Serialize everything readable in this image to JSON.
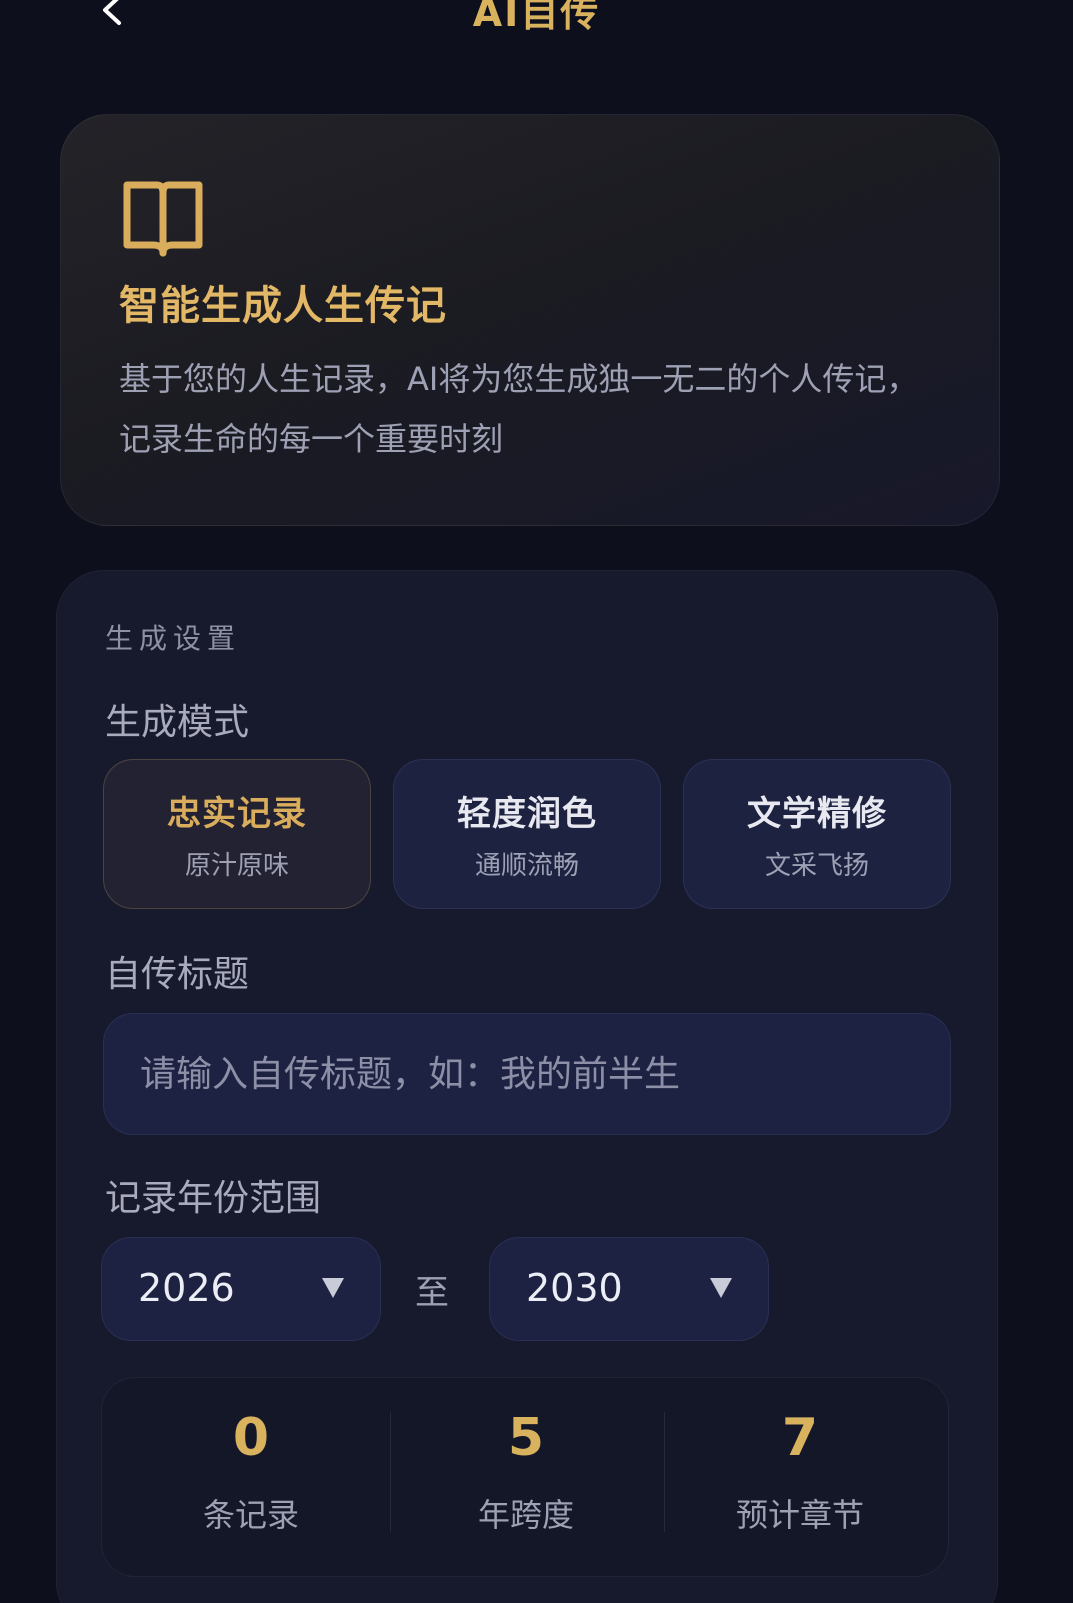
{
  "header": {
    "title": "AI自传",
    "back_icon": "chevron-left-icon"
  },
  "intro": {
    "icon": "book-icon",
    "title": "智能生成人生传记",
    "description": "基于您的人生记录，AI将为您生成独一无二的个人传记，记录生命的每一个重要时刻"
  },
  "settings": {
    "section_label": "生成设置",
    "mode_label": "生成模式",
    "modes": [
      {
        "title": "忠实记录",
        "subtitle": "原汁原味",
        "selected": true
      },
      {
        "title": "轻度润色",
        "subtitle": "通顺流畅",
        "selected": false
      },
      {
        "title": "文学精修",
        "subtitle": "文采飞扬",
        "selected": false
      }
    ],
    "title_label": "自传标题",
    "title_input": {
      "value": "",
      "placeholder": "请输入自传标题，如：我的前半生"
    },
    "year_label": "记录年份范围",
    "year_start": "2026",
    "year_end": "2030",
    "year_separator": "至",
    "stats": [
      {
        "value": "0",
        "label": "条记录"
      },
      {
        "value": "5",
        "label": "年跨度"
      },
      {
        "value": "7",
        "label": "预计章节"
      }
    ]
  },
  "colors": {
    "background": "#0e0f1c",
    "accent_gold": "#d9b25e",
    "card": "#171a2c",
    "field": "#1d2242"
  }
}
